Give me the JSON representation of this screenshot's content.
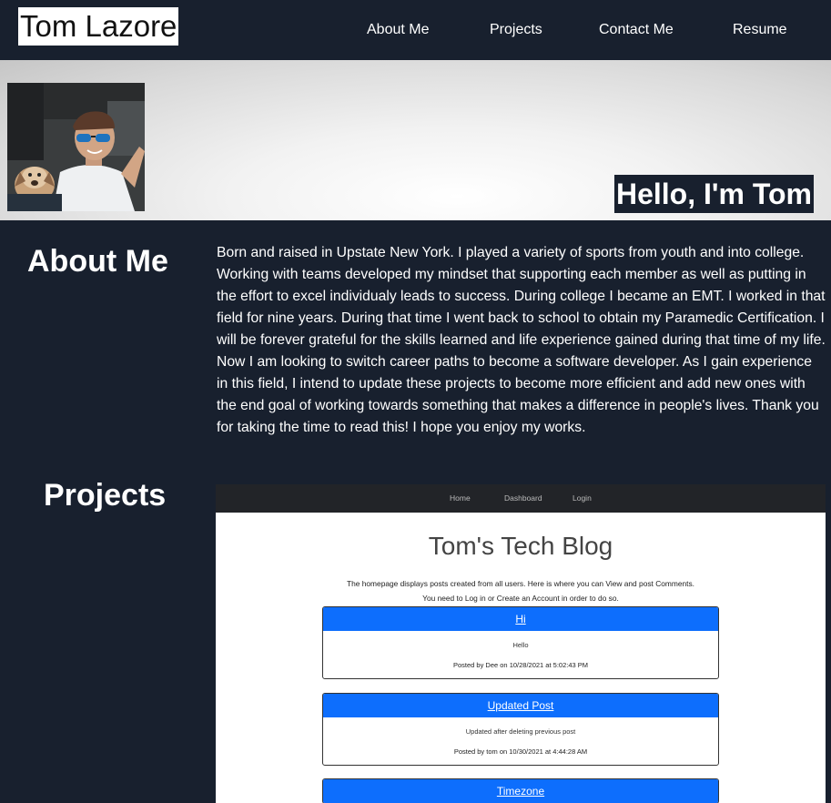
{
  "header": {
    "logo": "Tom Lazore",
    "nav": [
      "About Me",
      "Projects",
      "Contact Me",
      "Resume"
    ]
  },
  "hero": {
    "avatar_alt": "Photo of Tom with his dog in a car",
    "greeting": "Hello, I'm Tom"
  },
  "about": {
    "heading": "About Me",
    "text": "Born and raised in Upstate New York. I played a variety of sports from youth and into college. Working with teams developed my mindset that supporting each member as well as putting in the effort to excel individualy leads to success. During college I became an EMT. I worked in that field for nine years. During that time I went back to school to obtain my Paramedic Certification. I will be forever grateful for the skills learned and life experience gained during that time of my life. Now I am looking to switch career paths to become a software developer. As I gain experience in this field, I intend to update these projects to become more efficient and add new ones with the end goal of working towards something that makes a difference in people's lives. Thank you for taking the time to read this! I hope you enjoy my works."
  },
  "projects": {
    "heading": "Projects",
    "preview": {
      "nav": [
        "Home",
        "Dashboard",
        "Login"
      ],
      "title": "Tom's Tech Blog",
      "description_line1": "The homepage displays posts created from all users. Here is where you can View and post Comments.",
      "description_line2": "You need to Log in or Create an Account in order to do so.",
      "posts": [
        {
          "title": "Hi",
          "content": "Hello",
          "meta": "Posted by Dee on 10/28/2021 at 5:02:43 PM"
        },
        {
          "title": "Updated Post",
          "content": "Updated after deleting previous post",
          "meta": "Posted by tom on 10/30/2021 at 4:44:28 AM"
        },
        {
          "title": "Timezone",
          "content": "",
          "meta": ""
        }
      ]
    }
  },
  "colors": {
    "background": "#18202e",
    "accent_blue": "#0d6efd"
  }
}
